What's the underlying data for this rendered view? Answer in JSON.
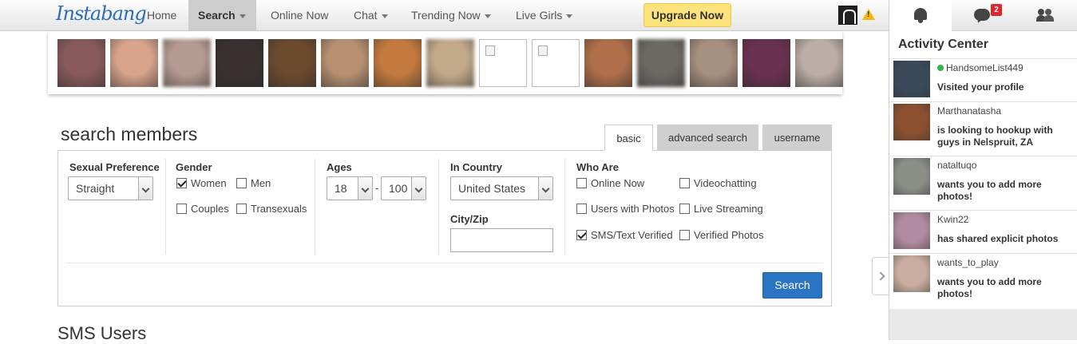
{
  "header": {
    "logo": "Instabang",
    "nav": [
      {
        "label": "Home"
      },
      {
        "label": "Search"
      },
      {
        "label": "Online Now"
      },
      {
        "label": "Chat"
      },
      {
        "label": "Trending Now"
      },
      {
        "label": "Live Girls"
      }
    ],
    "upgrade_label": "Upgrade Now"
  },
  "photo_strip": {
    "thumbnails": [
      {
        "color": "#8a5a5a"
      },
      {
        "color": "#d8a48c"
      },
      {
        "color": "#b59a90"
      },
      {
        "color": "#3a3030"
      },
      {
        "color": "#6b4a2e"
      },
      {
        "color": "#b89070"
      },
      {
        "color": "#c47a3e"
      },
      {
        "color": "#c2a98a"
      },
      {
        "color": "#ffffff"
      },
      {
        "color": "#ffffff"
      },
      {
        "color": "#b06f4a"
      },
      {
        "color": "#6c6864"
      },
      {
        "color": "#a89080"
      },
      {
        "color": "#6a3050"
      },
      {
        "color": "#bcaea6"
      }
    ]
  },
  "search": {
    "title": "search members",
    "tabs": [
      "basic",
      "advanced search",
      "username"
    ],
    "sexual_preference": {
      "label": "Sexual Preference",
      "value": "Straight"
    },
    "gender": {
      "label": "Gender",
      "options": [
        {
          "label": "Women",
          "checked": true
        },
        {
          "label": "Men",
          "checked": false
        },
        {
          "label": "Couples",
          "checked": false
        },
        {
          "label": "Transexuals",
          "checked": false
        }
      ]
    },
    "ages": {
      "label": "Ages",
      "min": "18",
      "separator": "-",
      "max": "100"
    },
    "country": {
      "label": "In Country",
      "value": "United States"
    },
    "city": {
      "label": "City/Zip",
      "value": ""
    },
    "who_are": {
      "label": "Who Are",
      "options": [
        {
          "label": "Online Now",
          "checked": false
        },
        {
          "label": "Videochatting",
          "checked": false
        },
        {
          "label": "Users with Photos",
          "checked": false
        },
        {
          "label": "Live Streaming",
          "checked": false
        },
        {
          "label": "SMS/Text Verified",
          "checked": true
        },
        {
          "label": "Verified Photos",
          "checked": false
        }
      ]
    },
    "button_label": "Search"
  },
  "next_section_title": "SMS Users",
  "sidebar": {
    "chat_badge": "2",
    "title": "Activity Center",
    "items": [
      {
        "user": "HandsomeList449",
        "online": true,
        "message": "Visited your profile",
        "color": "#3a4a5a"
      },
      {
        "user": "Marthanatasha",
        "online": false,
        "message": "is looking to hookup with guys in Nelspruit, ZA",
        "color": "#8a5030"
      },
      {
        "user": "nataltuqo",
        "online": false,
        "message": "wants you to add more photos!",
        "color": "#8a9088"
      },
      {
        "user": "Kwin22",
        "online": false,
        "message": "has shared explicit photos",
        "color": "#b08aa0"
      },
      {
        "user": "wants_to_play",
        "online": false,
        "message": "wants you to add more photos!",
        "color": "#c9ada0"
      }
    ]
  }
}
